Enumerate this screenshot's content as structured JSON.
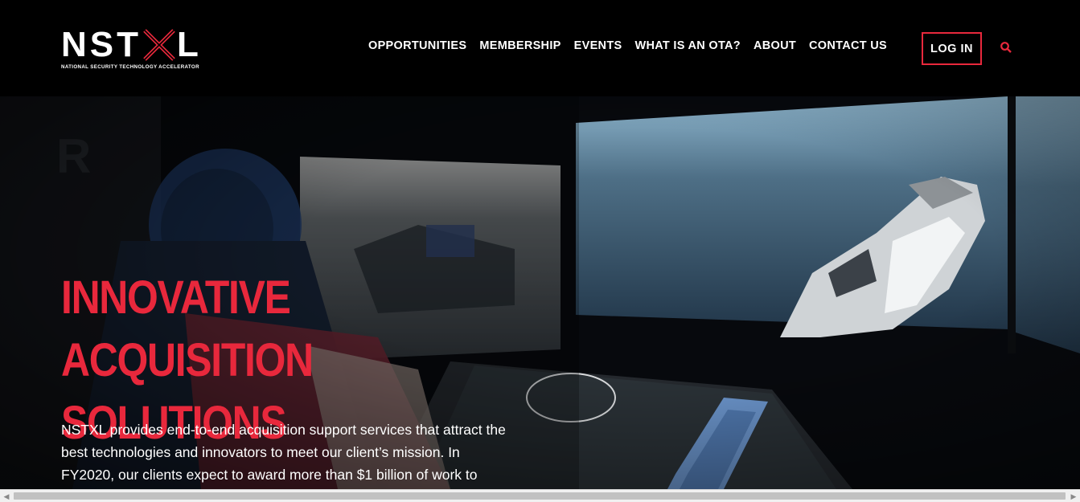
{
  "brand": {
    "name_part1": "NST",
    "name_part2": "L",
    "tagline": "NATIONAL SECURITY TECHNOLOGY ACCELERATOR",
    "accent_color": "#e8283c"
  },
  "nav": {
    "items": [
      {
        "label": "OPPORTUNITIES"
      },
      {
        "label": "MEMBERSHIP"
      },
      {
        "label": "EVENTS"
      },
      {
        "label": "WHAT IS AN OTA?"
      },
      {
        "label": "ABOUT"
      },
      {
        "label": "CONTACT US"
      }
    ],
    "login_label": "LOG IN",
    "search_icon": "search-icon"
  },
  "hero": {
    "title_line1": "INNOVATIVE ACQUISITION",
    "title_line2": "SOLUTIONS",
    "body": "NSTXL provides end-to-end acquisition support services that attract the best technologies and innovators to meet our client’s mission. In FY2020, our clients expect to award more than $1 billion of work to"
  }
}
